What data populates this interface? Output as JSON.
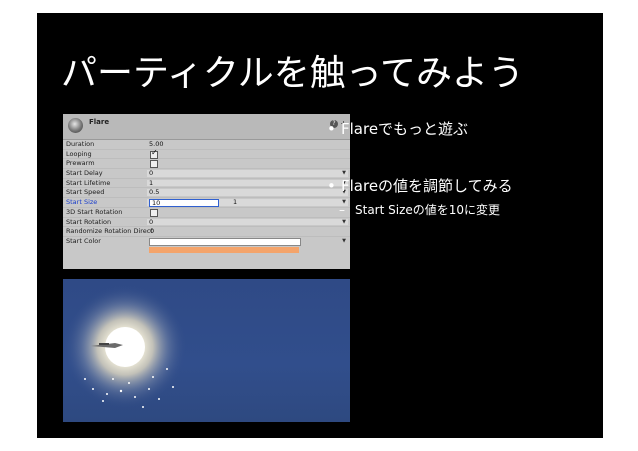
{
  "slide": {
    "title": "パーティクルを触ってみよう",
    "bullets": [
      {
        "marker": "•",
        "text": "Flareでもっと遊ぶ"
      },
      {
        "marker": "•",
        "text": "Flareの値を調節してみる"
      }
    ],
    "sub_bullet": {
      "marker": "–",
      "text": "Start Sizeの値を10に変更"
    }
  },
  "inspector": {
    "component_name": "Flare",
    "rows": {
      "duration": {
        "label": "Duration",
        "value": "5.00"
      },
      "looping": {
        "label": "Looping",
        "checked": true
      },
      "prewarm": {
        "label": "Prewarm",
        "checked": false
      },
      "start_delay": {
        "label": "Start Delay",
        "value": "0"
      },
      "start_lifetime": {
        "label": "Start Lifetime",
        "value": "1"
      },
      "start_speed": {
        "label": "Start Speed",
        "value": "0.5"
      },
      "start_size": {
        "label": "Start Size",
        "value": "10",
        "max": "1"
      },
      "rotation_3d": {
        "label": "3D Start Rotation",
        "checked": false
      },
      "start_rotation": {
        "label": "Start Rotation",
        "value": "0"
      },
      "randomize": {
        "label": "Randomize Rotation Direct",
        "value": "0"
      },
      "start_color": {
        "label": "Start Color"
      }
    },
    "start_color_hex": "#ffffff",
    "gradient_color_hex": "#f4a46b"
  },
  "scene": {
    "background_hex": "#2f4a86",
    "flare_color_hex": "#fffbe8"
  }
}
